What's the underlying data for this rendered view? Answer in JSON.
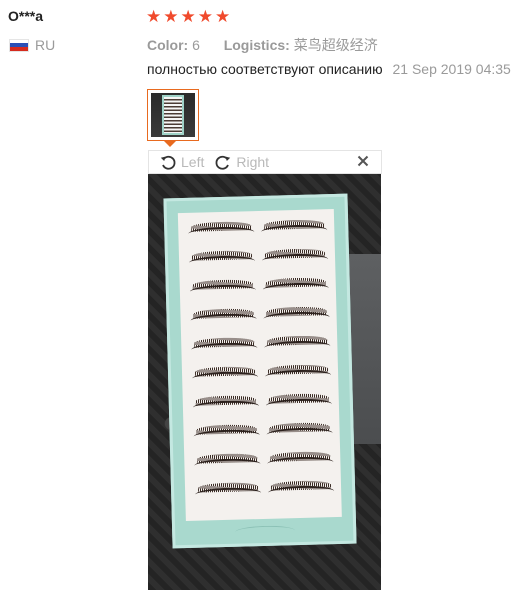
{
  "review": {
    "user_name": "O***a",
    "country_code": "RU",
    "rating": 5,
    "stars": [
      "★",
      "★",
      "★",
      "★",
      "★"
    ],
    "color_label": "Color:",
    "color_value": "6",
    "logistics_label": "Logistics:",
    "logistics_value": "菜鸟超级经济",
    "feedback_text": "полностью соответствуют описанию",
    "date": "21 Sep 2019 04:35"
  },
  "viewer": {
    "rotate_left_label": "Left",
    "rotate_right_label": "Right",
    "close_icon": "close-icon",
    "close_glyph": "✕"
  },
  "colors": {
    "star": "#f04a2c",
    "thumbnail_border": "#e86a1f",
    "muted_text": "#9a9a9a"
  }
}
